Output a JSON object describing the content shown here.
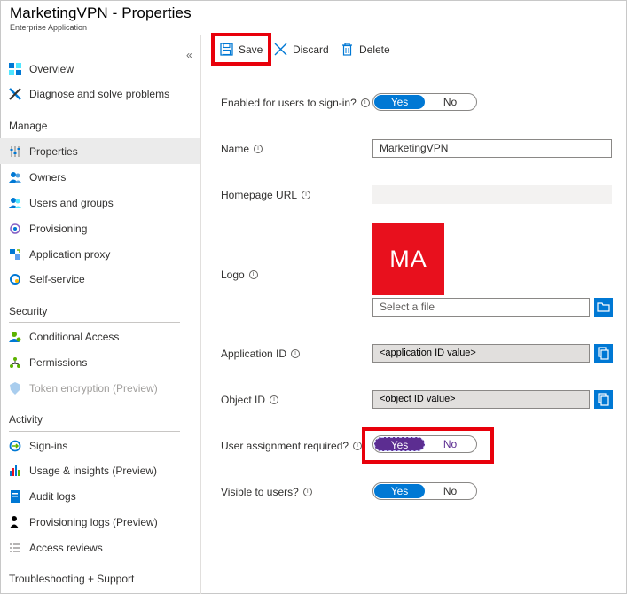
{
  "header": {
    "title": "MarketingVPN - Properties",
    "subtitle": "Enterprise Application"
  },
  "sidebar": {
    "collapse_glyph": "«",
    "top_items": [
      {
        "label": "Overview",
        "icon": "grid-icon"
      },
      {
        "label": "Diagnose and solve problems",
        "icon": "wrench-icon"
      }
    ],
    "manage": {
      "heading": "Manage",
      "items": [
        {
          "label": "Properties",
          "icon": "sliders-icon",
          "active": true
        },
        {
          "label": "Owners",
          "icon": "people-icon"
        },
        {
          "label": "Users and groups",
          "icon": "users-icon"
        },
        {
          "label": "Provisioning",
          "icon": "sync-icon"
        },
        {
          "label": "Application proxy",
          "icon": "proxy-icon"
        },
        {
          "label": "Self-service",
          "icon": "self-service-icon"
        }
      ]
    },
    "security": {
      "heading": "Security",
      "items": [
        {
          "label": "Conditional Access",
          "icon": "conditional-access-icon"
        },
        {
          "label": "Permissions",
          "icon": "permissions-icon"
        },
        {
          "label": "Token encryption (Preview)",
          "icon": "shield-icon",
          "disabled": true
        }
      ]
    },
    "activity": {
      "heading": "Activity",
      "items": [
        {
          "label": "Sign-ins",
          "icon": "sign-in-icon"
        },
        {
          "label": "Usage & insights (Preview)",
          "icon": "bar-chart-icon"
        },
        {
          "label": "Audit logs",
          "icon": "audit-log-icon"
        },
        {
          "label": "Provisioning logs (Preview)",
          "icon": "person-log-icon"
        },
        {
          "label": "Access reviews",
          "icon": "list-check-icon"
        }
      ]
    },
    "troubleshooting": {
      "heading": "Troubleshooting + Support"
    }
  },
  "toolbar": {
    "save_label": "Save",
    "discard_label": "Discard",
    "delete_label": "Delete"
  },
  "form": {
    "enabled_label": "Enabled for users to sign-in?",
    "enabled_yes": "Yes",
    "enabled_no": "No",
    "name_label": "Name",
    "name_value": "MarketingVPN",
    "homepage_label": "Homepage URL",
    "homepage_value": "",
    "logo_label": "Logo",
    "logo_initials": "MA",
    "file_placeholder": "Select a file",
    "app_id_label": "Application ID",
    "app_id_value": "<application ID value>",
    "object_id_label": "Object ID",
    "object_id_value": "<object ID value>",
    "assignment_label": "User assignment required?",
    "assignment_yes": "Yes",
    "assignment_no": "No",
    "visible_label": "Visible to users?",
    "visible_yes": "Yes",
    "visible_no": "No",
    "info_glyph": "i"
  },
  "colors": {
    "accent": "#0078d4",
    "highlight": "#e8000b",
    "toggle_purple": "#5c2d91",
    "logo_bg": "#e8101d"
  }
}
